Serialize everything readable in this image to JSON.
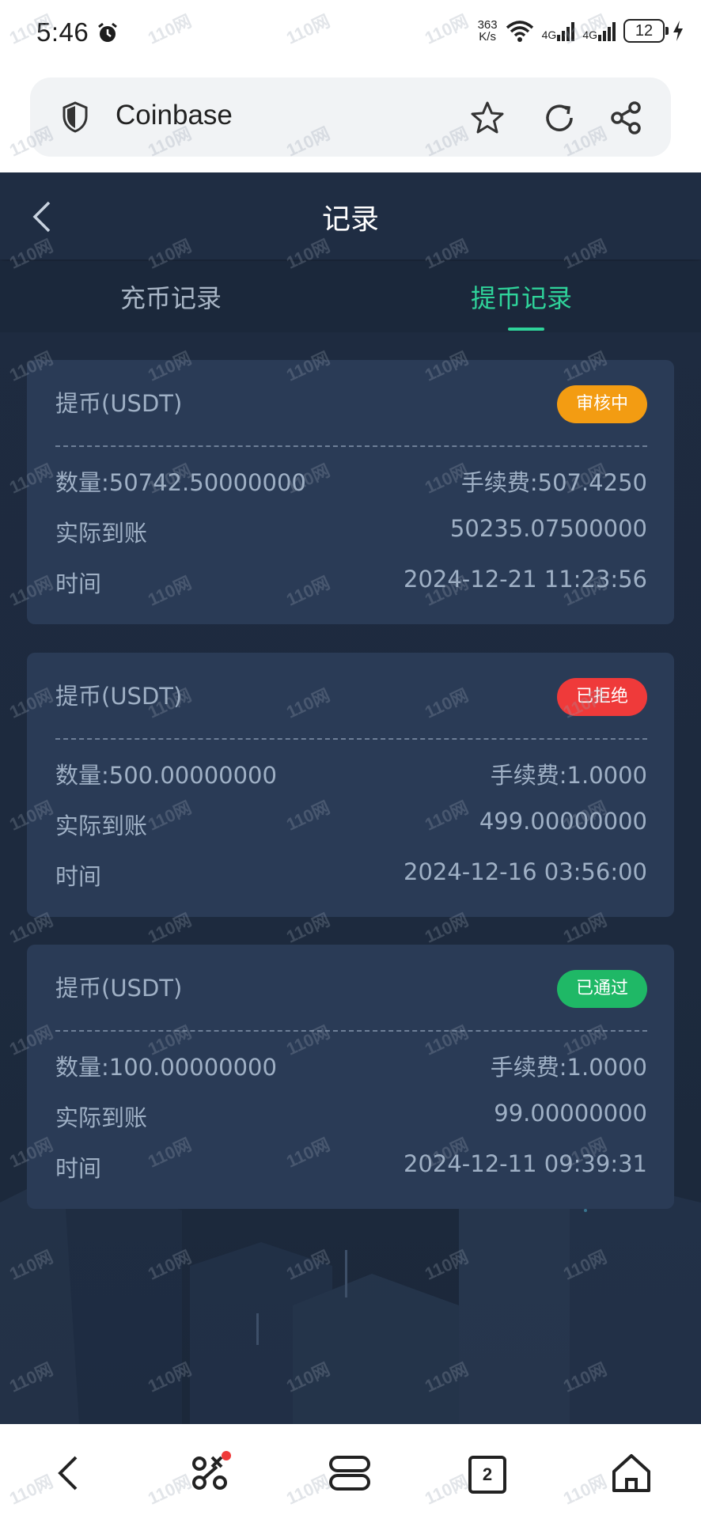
{
  "status_bar": {
    "time": "5:46",
    "net_speed_value": "363",
    "net_speed_unit": "K/s",
    "sim1": "4G",
    "sim2": "4G",
    "battery": "12"
  },
  "browser": {
    "site_name": "Coinbase"
  },
  "app": {
    "title": "记录",
    "tabs": [
      {
        "label": "充币记录",
        "active": false
      },
      {
        "label": "提币记录",
        "active": true
      }
    ],
    "records": [
      {
        "title": "提币(USDT)",
        "status": "审核中",
        "status_color": "#f39c12",
        "amount": "数量:50742.50000000",
        "fee": "手续费:507.4250",
        "received_label": "实际到账",
        "received_value": "50235.07500000",
        "time_label": "时间",
        "time_value": "2024-12-21 11:23:56"
      },
      {
        "title": "提币(USDT)",
        "status": "已拒绝",
        "status_color": "#ef3a3a",
        "amount": "数量:500.00000000",
        "fee": "手续费:1.0000",
        "received_label": "实际到账",
        "received_value": "499.00000000",
        "time_label": "时间",
        "time_value": "2024-12-16 03:56:00"
      },
      {
        "title": "提币(USDT)",
        "status": "已通过",
        "status_color": "#1fb866",
        "amount": "数量:100.00000000",
        "fee": "手续费:1.0000",
        "received_label": "实际到账",
        "received_value": "99.00000000",
        "time_label": "时间",
        "time_value": "2024-12-11 09:39:31"
      }
    ]
  },
  "bottom_nav": {
    "tab_count": "2"
  },
  "watermark": "110网",
  "colors": {
    "app_bg": "#1e2b40",
    "card_bg": "#2a3b56",
    "accent_green": "#2fd39a"
  }
}
